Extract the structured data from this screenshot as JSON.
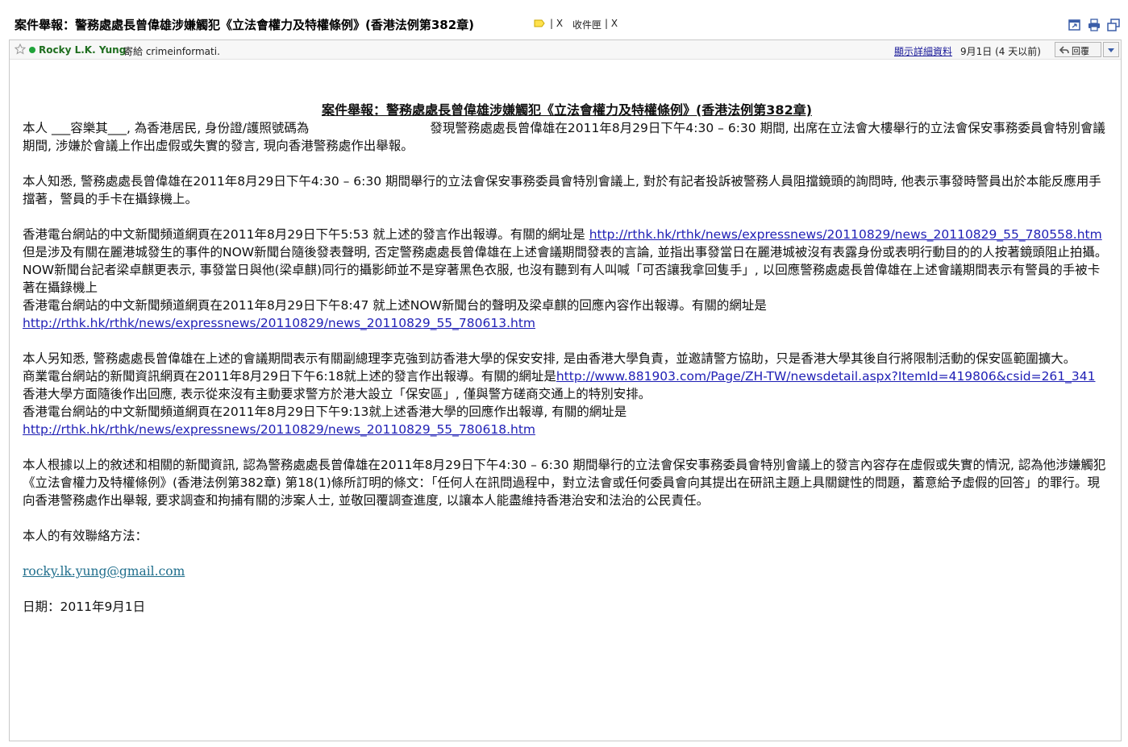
{
  "header": {
    "subject": "案件舉報：警務處處長曾偉雄涉嫌觸犯《立法會權力及特權條例》(香港法例第382章)",
    "label_x1": "X",
    "inbox_label": "收件匣",
    "label_x2": "X"
  },
  "message": {
    "sender": "Rocky L.K. Yung",
    "sent_to": "寄給 crimeinformati.",
    "details_link": "顯示詳細資料",
    "date": "9月1日 (4 天以前)",
    "reply_label": "回覆"
  },
  "body": {
    "title": "案件舉報：警務處處長曾偉雄涉嫌觸犯《立法會權力及特權條例》(香港法例第382章)",
    "p1_a": "本人 ",
    "p1_name": "___容樂其___",
    "p1_b": ", 為香港居民, 身份證/護照號碼為",
    "p1_c": "發現警務處處長曾偉雄在2011年8月29日下午4:30 – 6:30 期間, 出席在立法會大樓舉行的立法會保安事務委員會特別會議期間, 涉嫌於會議上作出虛假或失實的發言, 現向香港警務處作出舉報。",
    "p2": "本人知悉, 警務處處長曾偉雄在2011年8月29日下午4:30 – 6:30 期間舉行的立法會保安事務委員會特別會議上, 對於有記者投訴被警務人員阻擋鏡頭的詢問時, 他表示事發時警員出於本能反應用手擋著，警員的手卡在攝錄機上。",
    "p3_a": "香港電台網站的中文新聞頻道網頁在2011年8月29日下午5:53 就上述的發言作出報導。有關的網址是 ",
    "p3_link": "http://rthk.hk/rthk/news/expressnews/20110829/news_20110829_55_780558.htm",
    "p3_b": "但是涉及有關在麗港城發生的事件的NOW新聞台隨後發表聲明, 否定警務處處長曾偉雄在上述會議期間發表的言論, 並指出事發當日在麗港城被沒有表露身份或表明行動目的的人按著鏡頭阻止拍攝。",
    "p3_c": "NOW新聞台記者梁卓麒更表示, 事發當日與他(梁卓麒)同行的攝影師並不是穿著黑色衣服, 也沒有聽到有人叫喊「可否讓我拿回隻手」, 以回應警務處處長曾偉雄在上述會議期間表示有警員的手被卡著在攝錄機上",
    "p3_d": "香港電台網站的中文新聞頻道網頁在2011年8月29日下午8:47 就上述NOW新聞台的聲明及梁卓麒的回應內容作出報導。有關的網址是",
    "p3_link2": "http://rthk.hk/rthk/news/expressnews/20110829/news_20110829_55_780613.htm",
    "p4_a": "本人另知悉, 警務處處長曾偉雄在上述的會議期間表示有關副總理李克強到訪香港大學的保安安排, 是由香港大學負責，並邀請警方協助，只是香港大學其後自行將限制活動的保安區範圍擴大。",
    "p4_b": "商業電台網站的新聞資訊網頁在2011年8月29日下午6:18就上述的發言作出報導。有關的網址是",
    "p4_link": "http://www.881903.com/Page/ZH-TW/newsdetail.aspx?ItemId=419806&csid=261_341",
    "p4_c": "香港大學方面隨後作出回應, 表示從來沒有主動要求警方於港大設立「保安區」, 僅與警方磋商交通上的特別安排。",
    "p4_d": "香港電台網站的中文新聞頻道網頁在2011年8月29日下午9:13就上述香港大學的回應作出報導, 有關的網址是",
    "p4_link2": "http://rthk.hk/rthk/news/expressnews/20110829/news_20110829_55_780618.htm",
    "p5": "本人根據以上的敘述和相關的新聞資訊, 認為警務處處長曾偉雄在2011年8月29日下午4:30 – 6:30 期間舉行的立法會保安事務委員會特別會議上的發言內容存在虛假或失實的情況, 認為他涉嫌觸犯《立法會權力及特權條例》(香港法例第382章) 第18(1)條所訂明的條文：「任何人在訊問過程中，對立法會或任何委員會向其提出在研訊主題上具關鍵性的問題，蓄意給予虛假的回答」的罪行。現向香港警務處作出舉報, 要求調查和拘捕有關的涉案人士, 並敬回覆調查進度, 以讓本人能盡維持香港治安和法治的公民責任。",
    "p6": "本人的有效聯絡方法：",
    "email": "rocky.lk.yung@gmail.com",
    "p7": "日期：2011年9月1日"
  },
  "colors": {
    "link": "#1f1fb5",
    "sender": "#1f6e1f",
    "online_dot": "#20a33a",
    "email": "#1f6e8c"
  },
  "icons": [
    "label-tag-icon",
    "new-window-icon",
    "print-icon",
    "expand-icon",
    "star-icon",
    "reply-arrow-icon",
    "dropdown-arrow-icon"
  ]
}
